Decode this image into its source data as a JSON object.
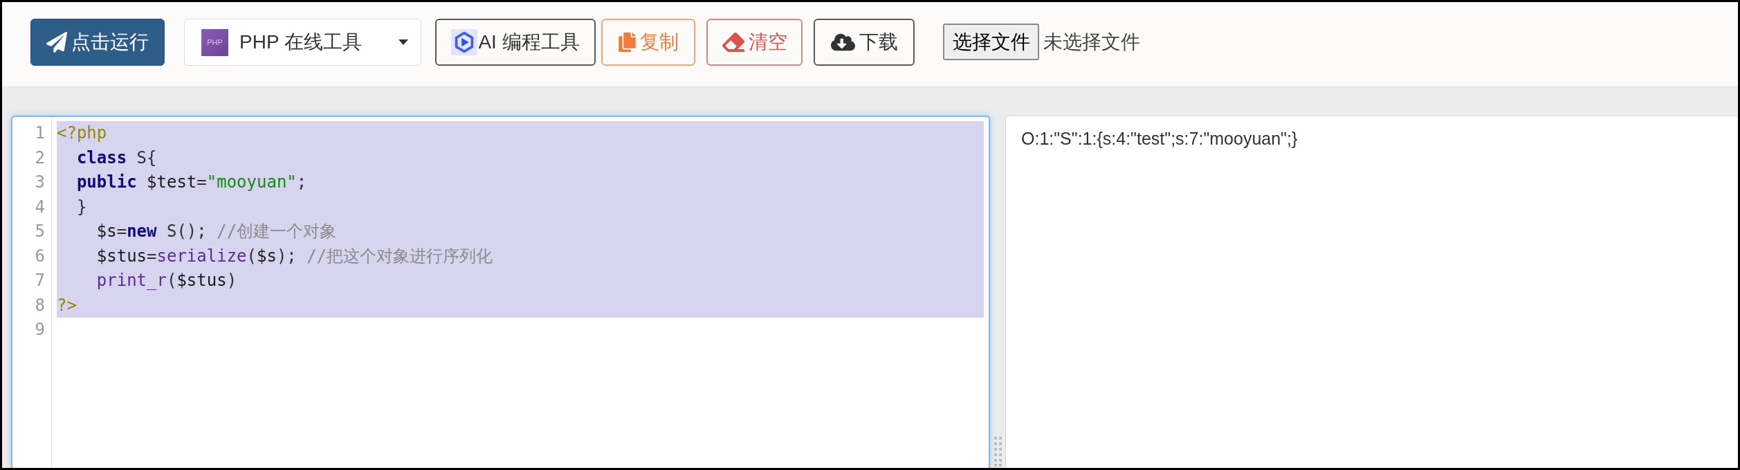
{
  "toolbar": {
    "items": [
      {
        "kind": "run",
        "label": "点击运行"
      },
      {
        "kind": "select",
        "logo_text": "PHP",
        "value": "PHP 在线工具"
      },
      {
        "kind": "ai",
        "label": "AI 编程工具"
      },
      {
        "kind": "copy",
        "label": "复制"
      },
      {
        "kind": "clear",
        "label": "清空"
      },
      {
        "kind": "download",
        "label": "下载"
      },
      {
        "kind": "file",
        "button_label": "选择文件",
        "status": "未选择文件"
      }
    ]
  },
  "editor": {
    "focused": true,
    "lines": [
      {
        "number": "1",
        "selected": true,
        "tokens": [
          {
            "kind": "meta",
            "text": "<?php"
          }
        ]
      },
      {
        "number": "2",
        "selected": true,
        "tokens": [
          {
            "kind": "keyword",
            "text": "  class"
          },
          {
            "kind": "plain",
            "text": " S{"
          }
        ]
      },
      {
        "number": "3",
        "selected": true,
        "tokens": [
          {
            "kind": "keyword",
            "text": "  public"
          },
          {
            "kind": "variable",
            "text": " $test"
          },
          {
            "kind": "plain",
            "text": "="
          },
          {
            "kind": "string",
            "text": "\"mooyuan\""
          },
          {
            "kind": "plain",
            "text": ";"
          }
        ]
      },
      {
        "number": "4",
        "selected": true,
        "tokens": [
          {
            "kind": "plain",
            "text": "  }"
          }
        ]
      },
      {
        "number": "5",
        "selected": true,
        "tokens": [
          {
            "kind": "variable",
            "text": "    $s"
          },
          {
            "kind": "plain",
            "text": "="
          },
          {
            "kind": "keyword",
            "text": "new"
          },
          {
            "kind": "plain",
            "text": " S();"
          },
          {
            "kind": "comment",
            "text": " //创建一个对象"
          }
        ]
      },
      {
        "number": "6",
        "selected": true,
        "tokens": [
          {
            "kind": "variable",
            "text": "    $stus"
          },
          {
            "kind": "plain",
            "text": "="
          },
          {
            "kind": "builtin",
            "text": "serialize"
          },
          {
            "kind": "plain",
            "text": "("
          },
          {
            "kind": "variable",
            "text": "$s"
          },
          {
            "kind": "plain",
            "text": ");"
          },
          {
            "kind": "comment",
            "text": " //把这个对象进行序列化"
          }
        ]
      },
      {
        "number": "7",
        "selected": true,
        "tokens": [
          {
            "kind": "builtin",
            "text": "    print_r"
          },
          {
            "kind": "plain",
            "text": "("
          },
          {
            "kind": "variable",
            "text": "$stus"
          },
          {
            "kind": "plain",
            "text": ")"
          }
        ]
      },
      {
        "number": "8",
        "selected": true,
        "tokens": [
          {
            "kind": "meta",
            "text": "?>"
          }
        ]
      },
      {
        "number": "9",
        "selected": false
      }
    ]
  },
  "output": {
    "text": "O:1:\"S\":1:{s:4:\"test\";s:7:\"mooyuan\";}"
  }
}
